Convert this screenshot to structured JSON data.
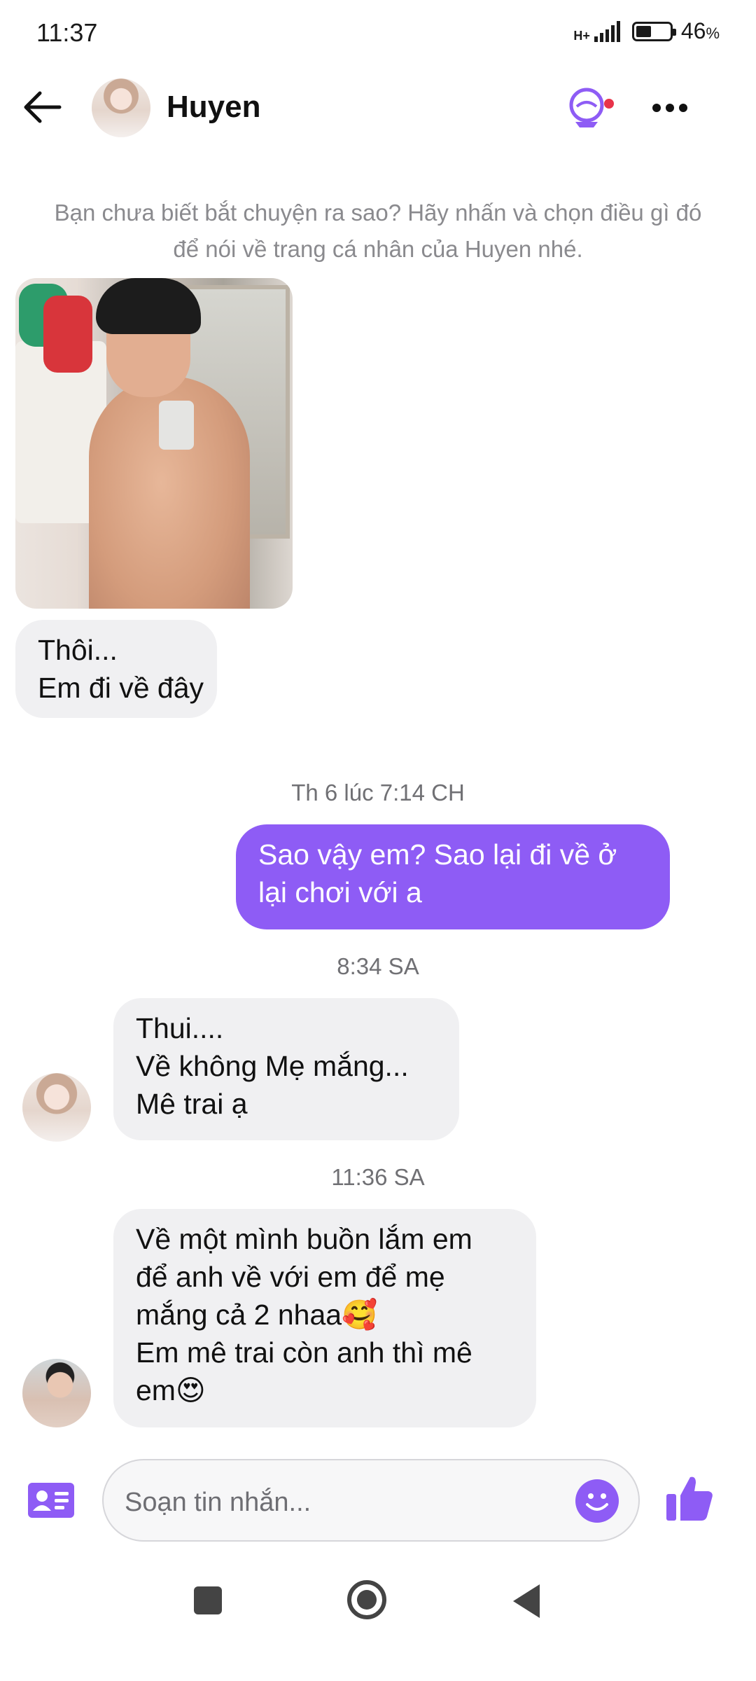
{
  "status_bar": {
    "time": "11:37",
    "network": "H+",
    "battery_percent": "46",
    "battery_fill": 0.46,
    "pct_sign": "%"
  },
  "header": {
    "contact_name": "Huyen",
    "icons": [
      "back-arrow-icon",
      "avatar",
      "call-robot-icon",
      "more-icon"
    ],
    "accent": "#8e5cf5",
    "badge_color": "#e8334a"
  },
  "hint": "Bạn chưa biết bắt chuyện ra sao? Hãy nhấn và chọn điều gì đó để nói về trang cá nhân của Huyen nhé.",
  "messages": [
    {
      "side": "incoming",
      "lines": [
        "Thôi...",
        "Em đi về đây"
      ]
    },
    {
      "timestamp": "Th 6 lúc 7:14 CH"
    },
    {
      "side": "outgoing",
      "lines": [
        "Sao vậy em? Sao lại đi về ở",
        "lại chơi với a"
      ]
    },
    {
      "timestamp": "8:34 SA"
    },
    {
      "side": "incoming",
      "lines": [
        "Thui....",
        "Về không Mẹ mắng...",
        "Mê trai ạ"
      ]
    },
    {
      "timestamp": "11:36 SA"
    },
    {
      "side": "incoming",
      "lines": [
        "Về một mình buồn lắm em",
        "để anh về với em để mẹ",
        "mắng cả 2 nhaa🥰",
        "Em mê trai còn anh thì mê",
        "em😍"
      ]
    }
  ],
  "composer": {
    "placeholder": "Soạn tin nhắn..."
  },
  "colors": {
    "outgoing_bubble": "#8e5cf5",
    "incoming_bubble": "#f0f0f2",
    "icon_purple": "#8e5cf5"
  }
}
